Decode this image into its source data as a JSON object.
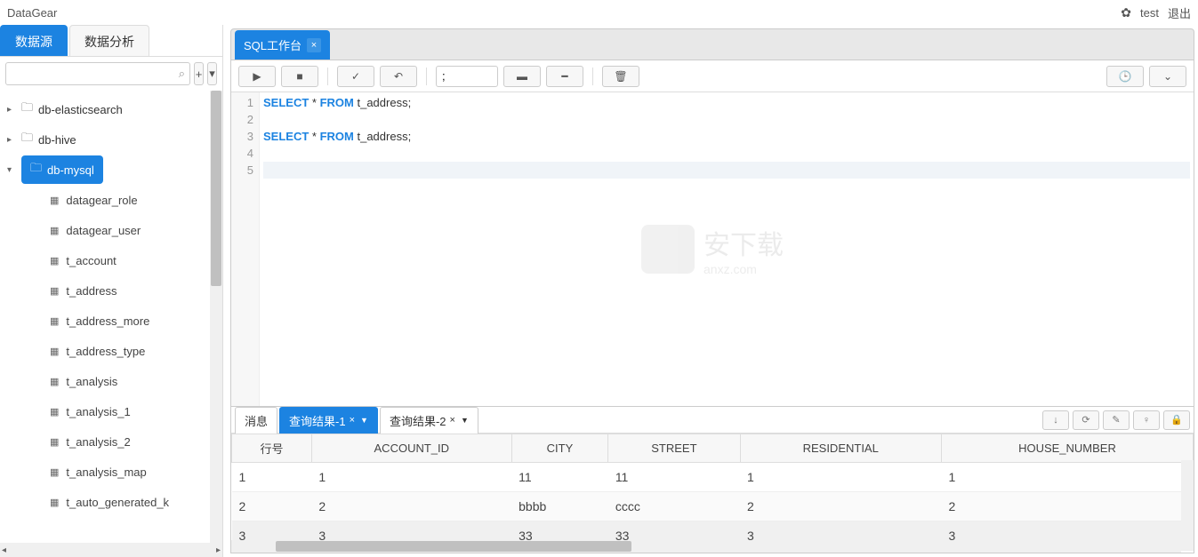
{
  "header": {
    "app_name": "DataGear",
    "user": "test",
    "logout": "退出"
  },
  "left": {
    "tabs": [
      "数据源",
      "数据分析"
    ],
    "tree": {
      "roots": [
        {
          "label": "db-elasticsearch",
          "expanded": false
        },
        {
          "label": "db-hive",
          "expanded": false
        },
        {
          "label": "db-mysql",
          "expanded": true,
          "selected": true
        }
      ],
      "children": [
        "datagear_role",
        "datagear_user",
        "t_account",
        "t_address",
        "t_address_more",
        "t_address_type",
        "t_analysis",
        "t_analysis_1",
        "t_analysis_2",
        "t_analysis_map",
        "t_auto_generated_k"
      ]
    }
  },
  "main_tab": {
    "label": "SQL工作台"
  },
  "toolbar": {
    "delim": ";"
  },
  "editor": {
    "lines": [
      {
        "n": 1,
        "tokens": [
          {
            "t": "SELECT",
            "k": true
          },
          {
            "t": " * ",
            "k": false
          },
          {
            "t": "FROM",
            "k": true
          },
          {
            "t": " t_address;",
            "k": false
          }
        ]
      },
      {
        "n": 2,
        "tokens": []
      },
      {
        "n": 3,
        "tokens": [
          {
            "t": "SELECT",
            "k": true
          },
          {
            "t": " * ",
            "k": false
          },
          {
            "t": "FROM",
            "k": true
          },
          {
            "t": " t_address;",
            "k": false
          }
        ]
      },
      {
        "n": 4,
        "tokens": []
      },
      {
        "n": 5,
        "tokens": [],
        "current": true
      }
    ]
  },
  "watermark": {
    "main": "安下载",
    "sub": "anxz.com"
  },
  "results": {
    "tabs": [
      "消息",
      "查询结果-1",
      "查询结果-2"
    ],
    "active_tab": 1,
    "columns": [
      "行号",
      "ACCOUNT_ID",
      "CITY",
      "STREET",
      "RESIDENTIAL",
      "HOUSE_NUMBER"
    ],
    "rows": [
      [
        "1",
        "1",
        "11",
        "11",
        "1",
        "1"
      ],
      [
        "2",
        "2",
        "bbbb",
        "cccc",
        "2",
        "2"
      ],
      [
        "3",
        "3",
        "33",
        "33",
        "3",
        "3"
      ]
    ]
  }
}
